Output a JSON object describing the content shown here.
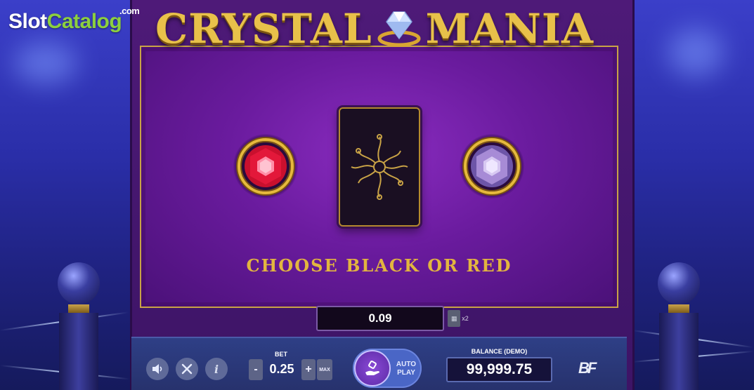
{
  "watermark": {
    "part1": "Slot",
    "part2": "Catalog",
    "suffix": ".com"
  },
  "logo": {
    "word1": "CRYSTAL",
    "word2": "MANIA"
  },
  "game": {
    "prompt": "CHOOSE BLACK OR RED",
    "win_amount": "0.09",
    "collect_icon": "card-stack-icon",
    "collect_multiplier": "x2",
    "left_gem": {
      "icon": "red-gem-icon",
      "color": "#e3183a"
    },
    "right_gem": {
      "icon": "purple-gem-icon",
      "color": "#a78bd6"
    },
    "card": {
      "icon": "card-back-ornament-icon"
    }
  },
  "toolbar": {
    "sound_icon": "speaker-icon",
    "settings_icon": "wrench-icon",
    "info_icon": "info-icon",
    "info_glyph": "i",
    "bet_label": "BET",
    "bet_value": "0.25",
    "minus_label": "-",
    "plus_label": "+",
    "max_label": "MAX",
    "autoplay_label": "AUTO PLAY",
    "balance_label": "BALANCE (DEMO)",
    "balance_value": "99,999.75",
    "provider_logo": "BF"
  },
  "colors": {
    "gold": "#e2b53f",
    "board_purple": "#6a1b9e",
    "toolbar_blue": "#2e3f86"
  }
}
